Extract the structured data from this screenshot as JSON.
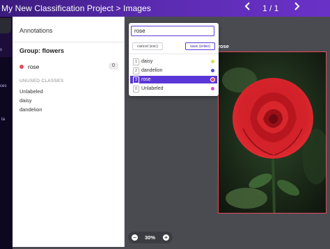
{
  "header": {
    "breadcrumb": "My New Classification Project > Images",
    "pagination": "1 / 1",
    "prev_icon": "chevron-left-icon",
    "next_icon": "chevron-right-icon"
  },
  "sidebar_nav": {
    "labels_visible": [
      "s",
      "ces",
      "ta"
    ]
  },
  "annotations_panel": {
    "title": "Annotations",
    "group_title": "Group: flowers",
    "active_classes": [
      {
        "name": "rose",
        "count": "0",
        "color": "#e54a5b"
      }
    ],
    "unused_title": "UNUSED CLASSES",
    "unused_classes": [
      "Unlabeled",
      "daisy",
      "dandelion"
    ]
  },
  "label_popup": {
    "input_value": "rose",
    "cancel_label": "cancel (esc)",
    "save_label": "save (enter)",
    "options": [
      {
        "key": "1",
        "name": "daisy",
        "color": "#d8e04a",
        "selected": false
      },
      {
        "key": "2",
        "name": "dandelion",
        "color": "#4b4bd6",
        "selected": false
      },
      {
        "key": "3",
        "name": "rose",
        "color": "#e54a5b",
        "selected": true
      },
      {
        "key": "0",
        "name": "Unlabeled",
        "color": "#d84ad0",
        "selected": false
      }
    ]
  },
  "image": {
    "box_label": "rose",
    "box_color": "#e54a5b",
    "subject": "red-rose-photo"
  },
  "zoom": {
    "value": "30%",
    "minus_icon": "minus-icon",
    "plus_icon": "plus-icon"
  },
  "colors": {
    "accent": "#5b36d6",
    "topbar_start": "#3a1b7c",
    "topbar_end": "#6a31c7",
    "canvas_bg": "#4a4b50"
  }
}
